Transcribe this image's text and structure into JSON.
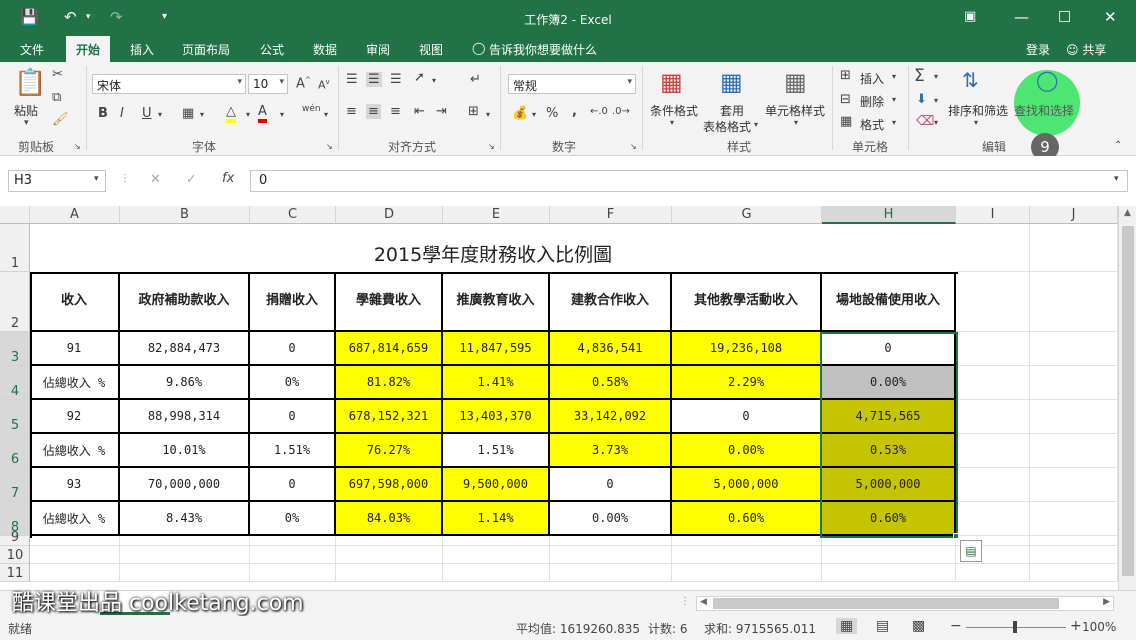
{
  "titlebar": {
    "title": "工作簿2 - Excel",
    "save_icon": "save-icon",
    "undo_icon": "undo-icon",
    "redo_icon": "redo-icon"
  },
  "tabs": [
    "文件",
    "开始",
    "插入",
    "页面布局",
    "公式",
    "数据",
    "审阅",
    "视图"
  ],
  "tellme": "告诉我你想要做什么",
  "login": "登录",
  "share": "共享",
  "ribbon": {
    "paste": "粘贴",
    "clipboard": "剪贴板",
    "font_name": "宋体",
    "font_size": "10",
    "font_group": "字体",
    "align_group": "对齐方式",
    "number_format": "常规",
    "number_group": "数字",
    "cond_format": "条件格式",
    "table_format_1": "套用",
    "table_format_2": "表格格式",
    "cell_style": "单元格样式",
    "style_group": "样式",
    "insert": "插入",
    "delete": "删除",
    "format": "格式",
    "cells_group": "单元格",
    "sort_filter": "排序和筛选",
    "find_select": "查找和选择",
    "edit_group": "编辑",
    "wen": "wén",
    "bold": "B",
    "italic": "I",
    "underline": "U",
    "percent": "%",
    "comma": ","
  },
  "badge": "9",
  "namebox": "H3",
  "formula": "0",
  "columns": [
    "A",
    "B",
    "C",
    "D",
    "E",
    "F",
    "G",
    "H",
    "I",
    "J"
  ],
  "rows": [
    "1",
    "2",
    "3",
    "4",
    "5",
    "6",
    "7",
    "8",
    "9",
    "10",
    "11"
  ],
  "sheet_title": "2015學年度財務收入比例圖",
  "table": {
    "headers": [
      "收入",
      "政府補助款收入",
      "捐贈收入",
      "學雜費收入",
      "推廣教育收入",
      "建教合作收入",
      "其他教學活動收入",
      "場地設備使用收入"
    ],
    "rows": [
      [
        "91",
        "82,884,473",
        "0",
        "687,814,659",
        "11,847,595",
        "4,836,541",
        "19,236,108",
        "0"
      ],
      [
        "佔總收入 %",
        "9.86%",
        "0%",
        "81.82%",
        "1.41%",
        "0.58%",
        "2.29%",
        "0.00%"
      ],
      [
        "92",
        "88,998,314",
        "0",
        "678,152,321",
        "13,403,370",
        "33,142,092",
        "0",
        "4,715,565"
      ],
      [
        "佔總收入 %",
        "10.01%",
        "1.51%",
        "76.27%",
        "1.51%",
        "3.73%",
        "0.00%",
        "0.53%"
      ],
      [
        "93",
        "70,000,000",
        "0",
        "697,598,000",
        "9,500,000",
        "0",
        "5,000,000",
        "5,000,000"
      ],
      [
        "佔總收入 %",
        "8.43%",
        "0%",
        "84.03%",
        "1.14%",
        "0.00%",
        "0.60%",
        "0.60%"
      ]
    ],
    "fills": [
      [
        "#ffffff",
        "#ffffff",
        "#ffffff",
        "#ffff00",
        "#ffff00",
        "#ffff00",
        "#ffff00",
        "#ffffff"
      ],
      [
        "#ffffff",
        "#ffffff",
        "#ffffff",
        "#ffff00",
        "#ffff00",
        "#ffff00",
        "#ffff00",
        "#c0c0c0"
      ],
      [
        "#ffffff",
        "#ffffff",
        "#ffffff",
        "#ffff00",
        "#ffff00",
        "#ffff00",
        "#ffffff",
        "#c4c400"
      ],
      [
        "#ffffff",
        "#ffffff",
        "#ffffff",
        "#ffff00",
        "#ffffff",
        "#ffff00",
        "#ffff00",
        "#c4c400"
      ],
      [
        "#ffffff",
        "#ffffff",
        "#ffffff",
        "#ffff00",
        "#ffff00",
        "#ffffff",
        "#ffff00",
        "#c4c400"
      ],
      [
        "#ffffff",
        "#ffffff",
        "#ffffff",
        "#ffff00",
        "#ffff00",
        "#ffffff",
        "#ffff00",
        "#c4c400"
      ]
    ]
  },
  "watermark": "酷课堂出品 coolketang.com",
  "status": {
    "ready": "就绪",
    "average": "平均值: 1619260.835",
    "count": "计数: 6",
    "sum": "求和: 9715565.011",
    "zoom": "100%"
  }
}
